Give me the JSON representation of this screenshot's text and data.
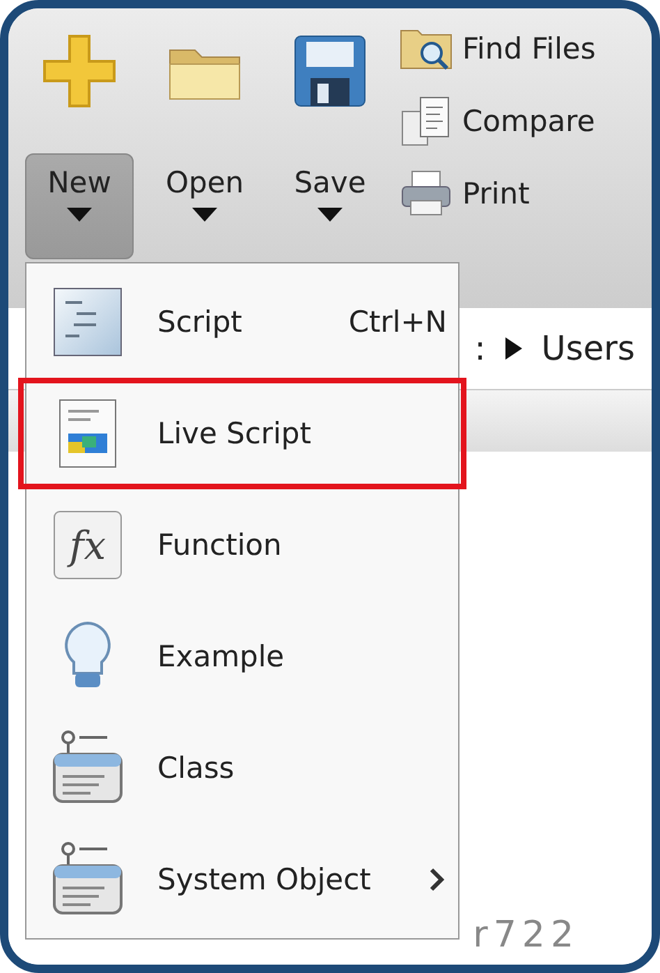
{
  "toolstrip": {
    "large_buttons": [
      {
        "kind": "plus",
        "label": "New",
        "pressed": true
      },
      {
        "kind": "folder",
        "label": "Open",
        "pressed": false
      },
      {
        "kind": "disk",
        "label": "Save",
        "pressed": false
      }
    ],
    "small_buttons": [
      {
        "kind": "find",
        "label": "Find Files"
      },
      {
        "kind": "compare",
        "label": "Compare"
      },
      {
        "kind": "print",
        "label": "Print"
      }
    ]
  },
  "address_bar": {
    "segments": [
      ":",
      "Users"
    ]
  },
  "workspace": {
    "text": "r722"
  },
  "new_menu": {
    "items": [
      {
        "kind": "script",
        "label": "Script",
        "shortcut": "Ctrl+N",
        "highlighted": false,
        "submenu": false
      },
      {
        "kind": "live",
        "label": "Live Script",
        "highlighted": true,
        "submenu": false
      },
      {
        "kind": "function",
        "icon_text": "fx",
        "label": "Function",
        "highlighted": false,
        "submenu": false
      },
      {
        "kind": "example",
        "label": "Example",
        "highlighted": false,
        "submenu": false
      },
      {
        "kind": "class",
        "label": "Class",
        "highlighted": false,
        "submenu": false
      },
      {
        "kind": "class",
        "label": "System Object",
        "highlighted": false,
        "submenu": true
      }
    ]
  }
}
